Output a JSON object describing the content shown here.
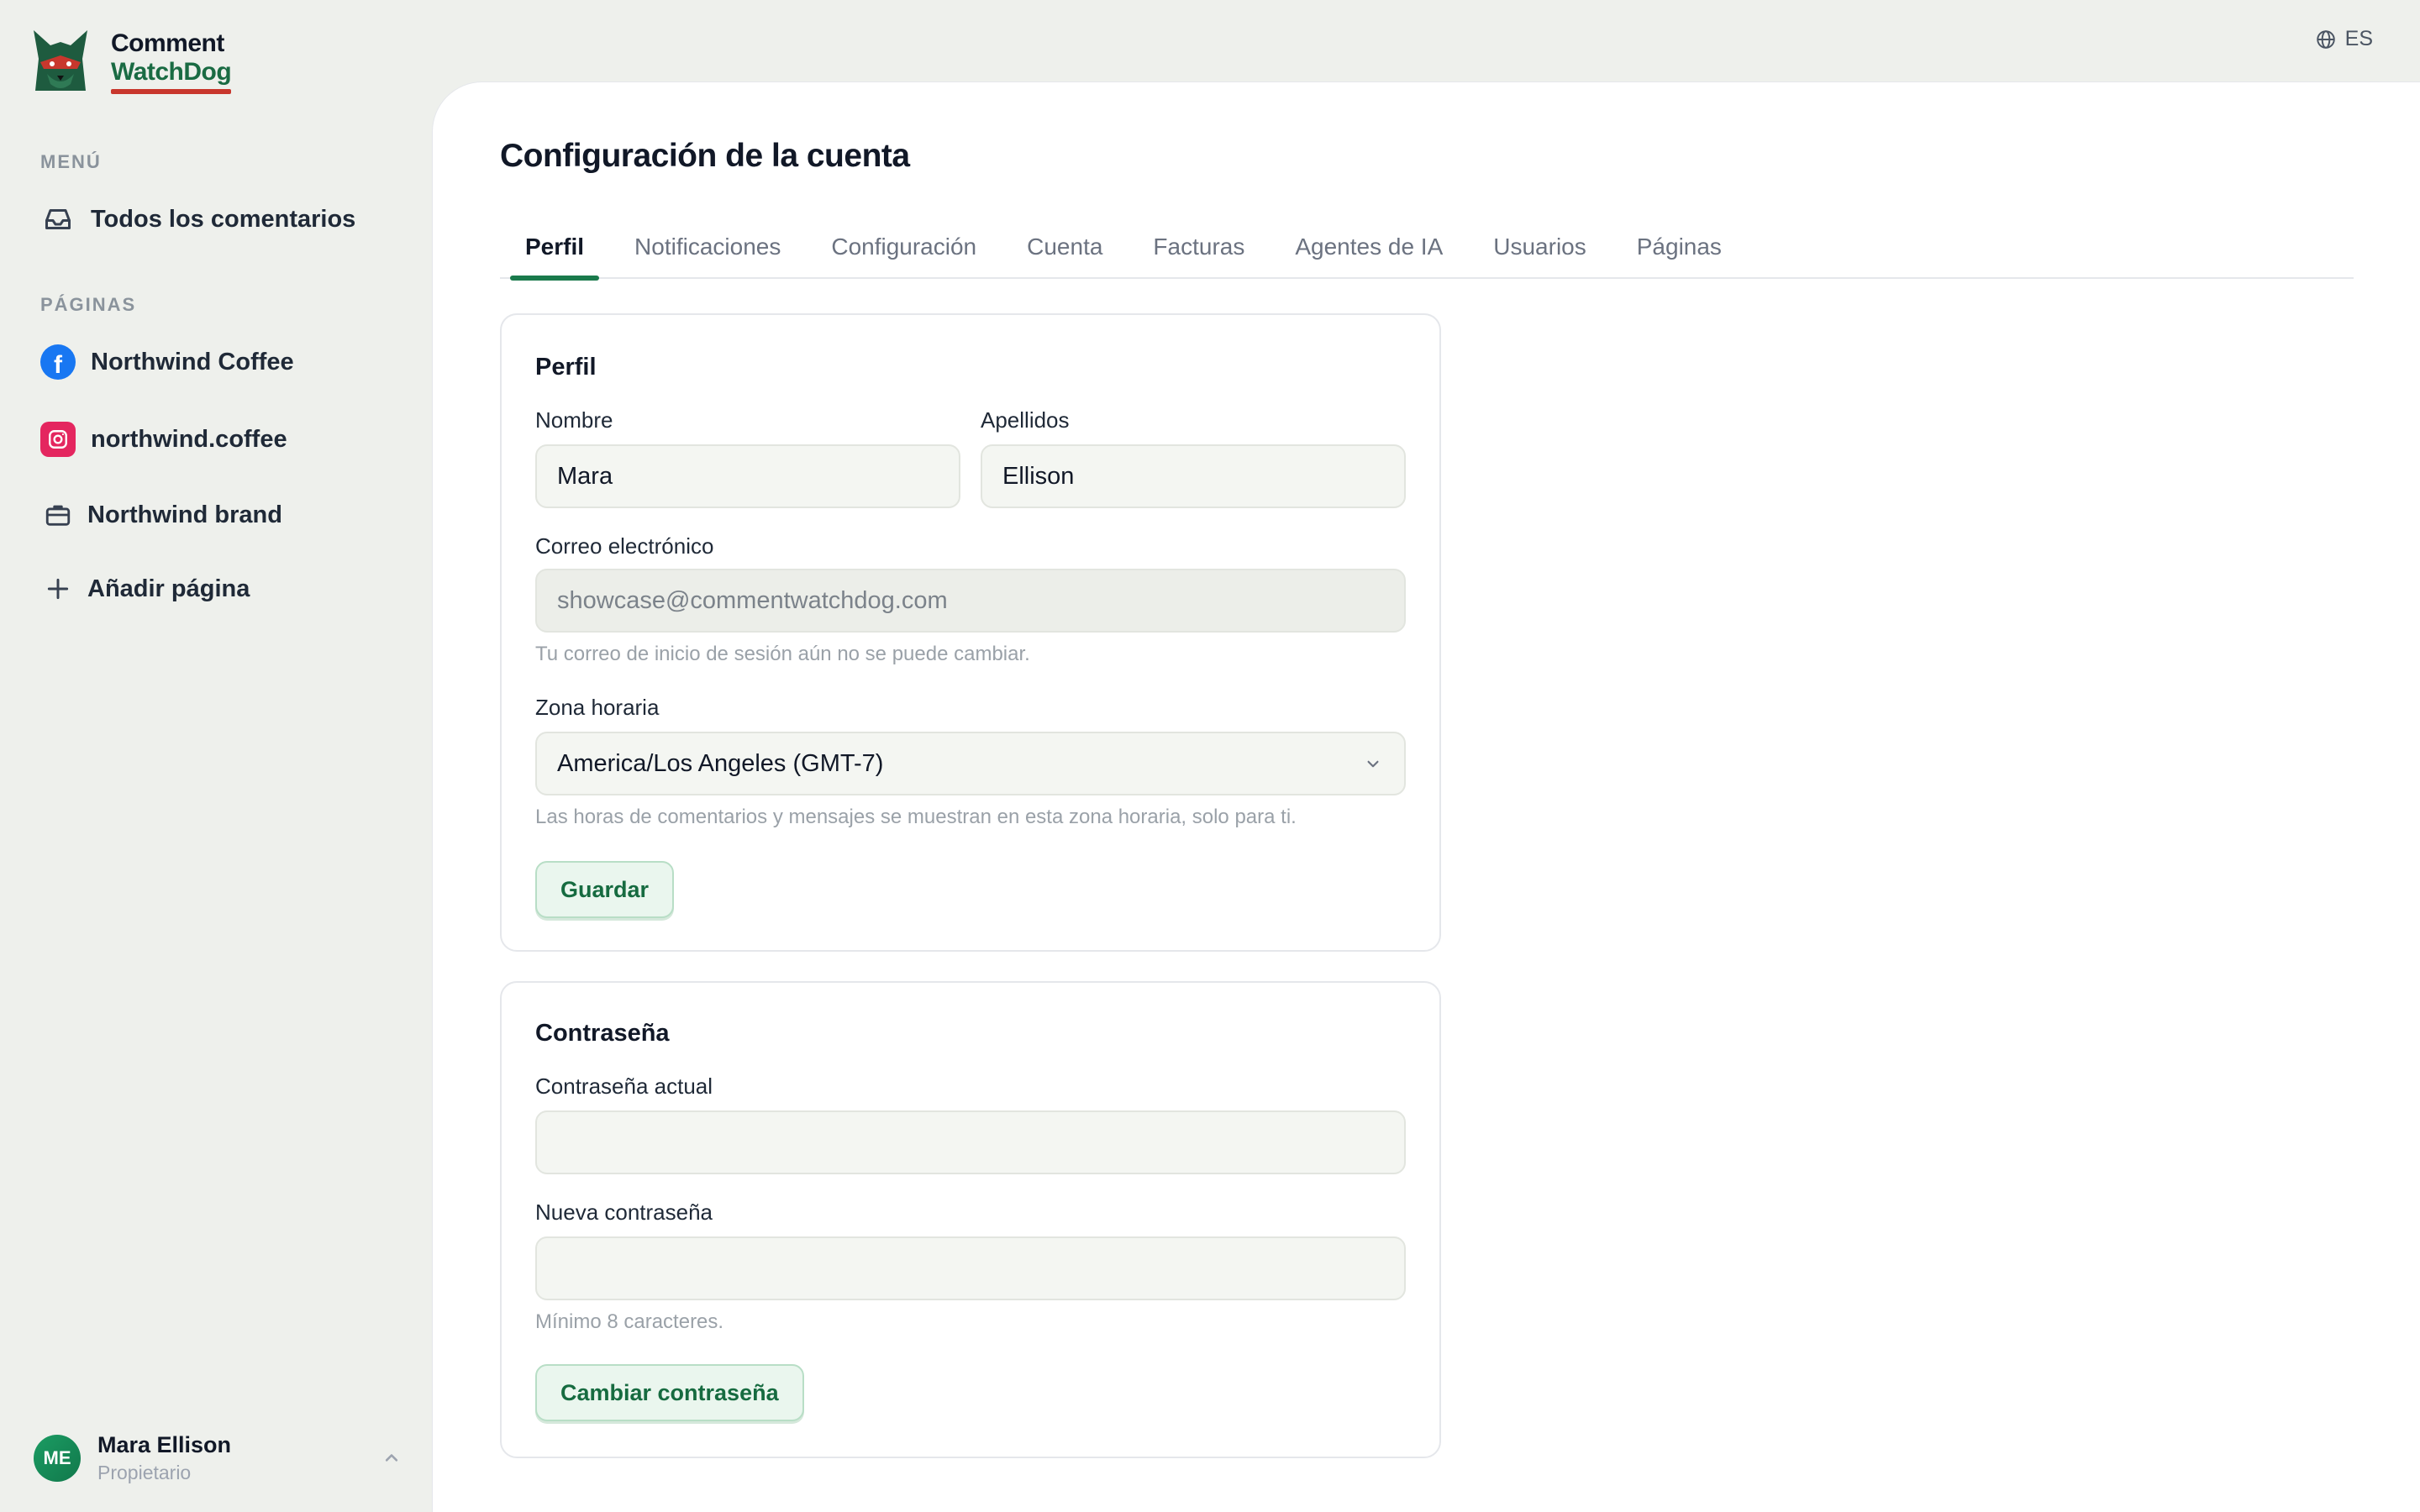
{
  "brand": {
    "line1": "Comment",
    "line2": "WatchDog"
  },
  "lang": {
    "code": "ES"
  },
  "sidebar": {
    "menu_label": "MENÚ",
    "menu_items": [
      {
        "label": "Todos los comentarios",
        "icon": "inbox-icon"
      }
    ],
    "pages_label": "PÁGINAS",
    "pages": [
      {
        "label": "Northwind Coffee",
        "icon": "facebook-icon"
      },
      {
        "label": "northwind.coffee",
        "icon": "instagram-icon"
      },
      {
        "label": "Northwind brand",
        "icon": "briefcase-icon"
      }
    ],
    "add_page": "Añadir página"
  },
  "user": {
    "initials": "ME",
    "name": "Mara Ellison",
    "role": "Propietario"
  },
  "main": {
    "title": "Configuración de la cuenta",
    "tabs": [
      "Perfil",
      "Notificaciones",
      "Configuración",
      "Cuenta",
      "Facturas",
      "Agentes de IA",
      "Usuarios",
      "Páginas"
    ],
    "active_tab": "Perfil"
  },
  "profile": {
    "title": "Perfil",
    "first_name_label": "Nombre",
    "first_name": "Mara",
    "last_name_label": "Apellidos",
    "last_name": "Ellison",
    "email_label": "Correo electrónico",
    "email": "showcase@commentwatchdog.com",
    "email_hint": "Tu correo de inicio de sesión aún no se puede cambiar.",
    "timezone_label": "Zona horaria",
    "timezone": "America/Los Angeles (GMT-7)",
    "timezone_hint": "Las horas de comentarios y mensajes se muestran en esta zona horaria, solo para ti.",
    "save": "Guardar"
  },
  "password": {
    "title": "Contraseña",
    "current_label": "Contraseña actual",
    "current_value": "",
    "new_label": "Nueva contraseña",
    "new_value": "",
    "hint": "Mínimo 8 caracteres.",
    "change": "Cambiar contraseña"
  },
  "colors": {
    "accent": "#1a7a4c",
    "brand_red": "#c8372d",
    "facebook": "#1877f2",
    "instagram": "#e4265f"
  }
}
